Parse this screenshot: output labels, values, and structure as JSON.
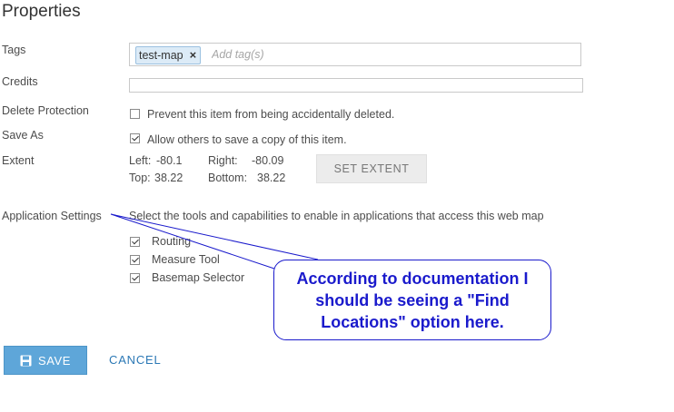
{
  "page": {
    "title": "Properties"
  },
  "tags": {
    "label": "Tags",
    "chips": [
      {
        "text": "test-map",
        "remove_symbol": "×"
      }
    ],
    "placeholder": "Add tag(s)"
  },
  "credits": {
    "label": "Credits",
    "value": ""
  },
  "delete_protection": {
    "label": "Delete Protection",
    "checkbox_label": "Prevent this item from being accidentally deleted.",
    "checked": false
  },
  "save_as": {
    "label": "Save As",
    "checkbox_label": "Allow others to save a copy of this item.",
    "checked": true
  },
  "extent": {
    "label": "Extent",
    "left_label": "Left:",
    "left_value": "-80.1",
    "right_label": "Right:",
    "right_value": "-80.09",
    "top_label": "Top:",
    "top_value": "38.22",
    "bottom_label": "Bottom:",
    "bottom_value": "38.22",
    "set_button": "SET EXTENT"
  },
  "application_settings": {
    "label": "Application Settings",
    "description": "Select the tools and capabilities to enable in applications that access this web map",
    "options": [
      {
        "label": "Routing",
        "checked": true
      },
      {
        "label": "Measure Tool",
        "checked": true
      },
      {
        "label": "Basemap Selector",
        "checked": true
      }
    ]
  },
  "actions": {
    "save_label": "SAVE",
    "cancel_label": "CANCEL",
    "save_icon": "floppy-disk-icon"
  },
  "annotation": {
    "text": "According to documentation I should be seeing a \"Find Locations\" option here.",
    "color": "#1a1acc"
  },
  "colors": {
    "primary": "#5ea6d9",
    "link": "#2b78b5",
    "chip_bg": "#dcebf7"
  }
}
